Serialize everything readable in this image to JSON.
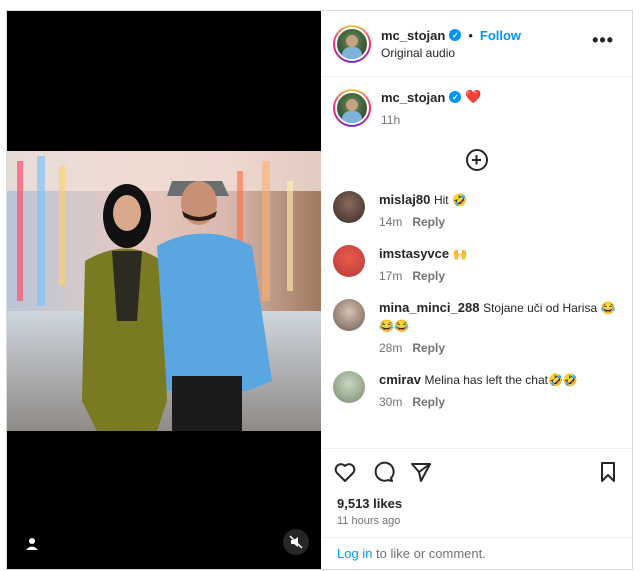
{
  "header": {
    "username": "mc_stojan",
    "follow_label": "Follow",
    "dot": "•",
    "audio": "Original audio",
    "more": "•••"
  },
  "caption": {
    "username": "mc_stojan",
    "emoji": "❤️",
    "time": "11h"
  },
  "add_comment_icon": "+",
  "comments": [
    {
      "user": "mislaj80",
      "text": "Hit 🤣",
      "time": "14m",
      "reply": "Reply"
    },
    {
      "user": "imstasyvce",
      "text": "🙌",
      "time": "17m",
      "reply": "Reply"
    },
    {
      "user": "mina_minci_288",
      "text": "Stojane uči od Harisa 😂😂😂",
      "time": "28m",
      "reply": "Reply"
    },
    {
      "user": "cmirav",
      "text": "Melina has left the chat🤣🤣",
      "time": "30m",
      "reply": "Reply"
    }
  ],
  "stats": {
    "likes": "9,513 likes",
    "time_ago": "11 hours ago"
  },
  "login": {
    "link": "Log in",
    "rest": " to like or comment."
  },
  "icons": [
    "heart-icon",
    "comment-icon",
    "share-icon",
    "bookmark-icon",
    "mute-icon",
    "person-icon",
    "more-icon",
    "verified-icon",
    "add-comment-icon"
  ],
  "colors": {
    "accent": "#0095f6",
    "text": "#262626",
    "muted": "#737373"
  }
}
